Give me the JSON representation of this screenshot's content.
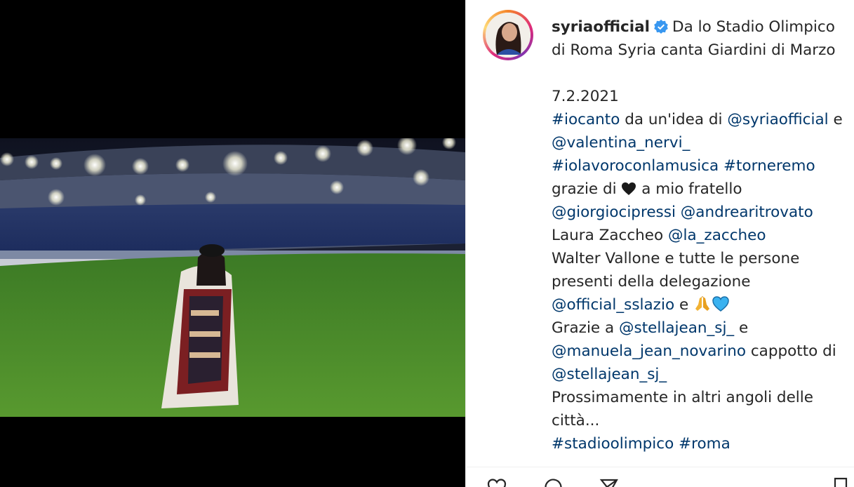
{
  "post": {
    "username": "syriaofficial",
    "title_line1": "Da lo Stadio Olimpico",
    "title_line2": "di Roma Syria canta Giardini di Marzo",
    "date": "7.2.2021",
    "hashtag_iocanto": "#iocanto",
    "text_idea": " da un'idea di ",
    "mention_syria": "@syriaofficial",
    "text_e": " e",
    "mention_valentina": "@valentina_nervi_",
    "hashtag_iolavoro": "#iolavoroconlamusica",
    "hashtag_torneremo": "#torneremo",
    "text_grazie_di": "grazie di ",
    "text_fratello": " a mio fratello",
    "mention_giorgio": "@giorgiocipressi",
    "mention_andrea": "@andrearitrovato",
    "text_laura": "Laura Zaccheo ",
    "mention_zaccheo": "@la_zaccheo",
    "text_walter": "Walter Vallone e tutte le persone",
    "text_presenti": "presenti della delegazione",
    "mention_lazio": "@official_sslazio",
    "text_e2": " e ",
    "text_grazie_a": "Grazie a ",
    "mention_stella1": "@stellajean_sj_",
    "text_e3": " e",
    "mention_manuela": "@manuela_jean_novarino",
    "text_cappotto": " cappotto di",
    "mention_stella2": "@stellajean_sj_",
    "text_prossimamente": "Prossimamente in altri angoli delle",
    "text_citta": "città...",
    "hashtag_stadio": "#stadioolimpico",
    "hashtag_roma": "#roma"
  },
  "icons": [
    "verified-badge-icon",
    "black-heart-icon",
    "folded-hands-icon",
    "blue-heart-icon",
    "like-icon",
    "comment-icon",
    "share-icon",
    "bookmark-icon"
  ],
  "colors": {
    "text": "#262626",
    "link": "#00376b",
    "verified": "#3897f0",
    "video_bg": "#000000",
    "grass": "#4c8a2b"
  }
}
